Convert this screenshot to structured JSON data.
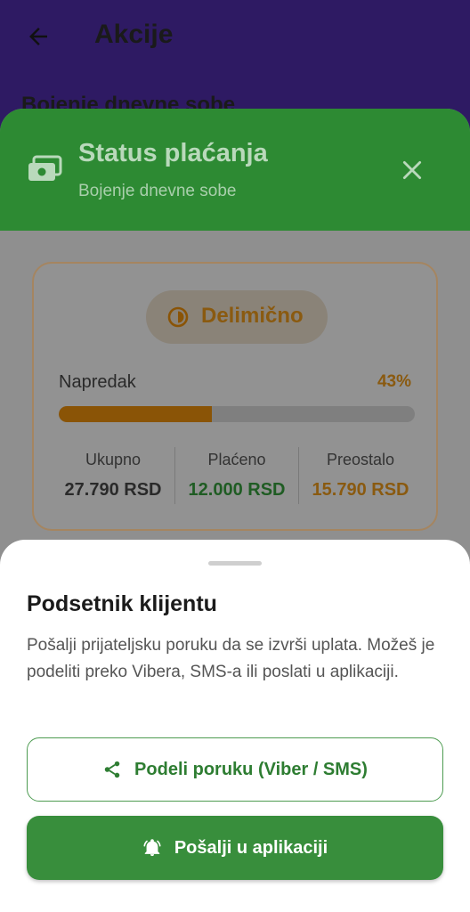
{
  "app_bar": {
    "title": "Akcije",
    "subtitle": "Bojenje dnevne sobe",
    "back_icon": "arrow-left-icon"
  },
  "dialog": {
    "title": "Status plaćanja",
    "subtitle": "Bojenje dnevne sobe",
    "icon": "payments-icon",
    "close_icon": "close-icon",
    "header_color": "#2d8a33",
    "status": {
      "label": "Delimično",
      "icon": "half-circle-icon",
      "color": "#e89313"
    },
    "progress": {
      "label": "Napredak",
      "percent_text": "43%",
      "fraction": 0.43
    },
    "stats": [
      {
        "label": "Ukupno",
        "value": "27.790 RSD"
      },
      {
        "label": "Plaćeno",
        "value": "12.000 RSD"
      },
      {
        "label": "Preostalo",
        "value": "15.790 RSD"
      }
    ]
  },
  "sheet": {
    "title": "Podsetnik klijentu",
    "body": "Pošalji prijateljsku poruku da se izvrši uplata. Možeš je podeliti preko Vibera, SMS-a ili poslati u aplikaciji.",
    "share_button": {
      "label": "Podeli poruku (Viber / SMS)",
      "icon": "share-icon"
    },
    "send_button": {
      "label": "Pošalji u aplikaciji",
      "icon": "bell-icon"
    },
    "accent_color": "#388e3c"
  }
}
